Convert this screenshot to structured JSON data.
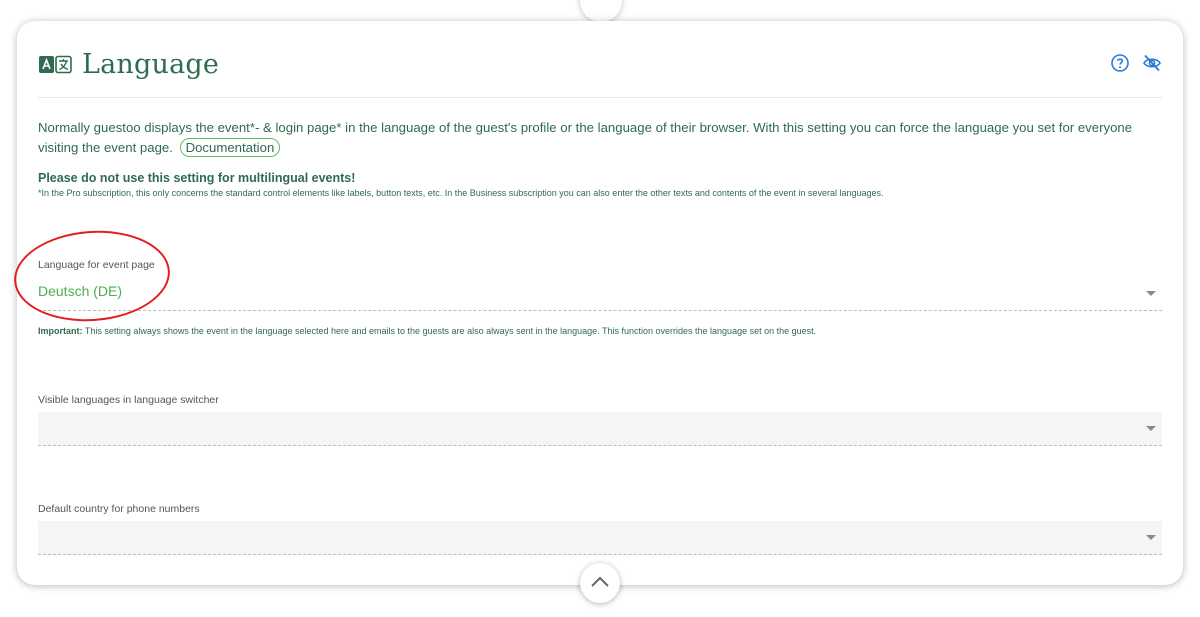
{
  "header": {
    "title": "Language",
    "icon": "language-icon",
    "help_icon": "help-circle-icon",
    "visibility_icon": "eye-off-icon"
  },
  "intro": {
    "text": "Normally guestoo displays the event*- & login page* in the language of the guest's profile or the language of their browser. With this setting you can force the language you set for everyone visiting the event page.",
    "link_label": "Documentation"
  },
  "warning": {
    "title": "Please do not use this setting for multilingual events!",
    "note": "*In the Pro subscription, this only concerns the standard control elements like labels, button texts, etc. In the Business subscription you can also enter the other texts and contents of the event in several languages."
  },
  "fields": {
    "event_language": {
      "label": "Language for event page",
      "value": "Deutsch (DE)"
    },
    "important": {
      "prefix": "Important:",
      "text": " This setting always shows the event in the language selected here and emails to the guests are also always sent in the language. This function overrides the language set on the guest."
    },
    "visible_languages": {
      "label": "Visible languages in language switcher",
      "value": ""
    },
    "default_country": {
      "label": "Default country for phone numbers",
      "value": ""
    }
  },
  "colors": {
    "accent_green": "#4caf50",
    "text_green": "#2f6b4f",
    "annotation_red": "#e02020"
  }
}
